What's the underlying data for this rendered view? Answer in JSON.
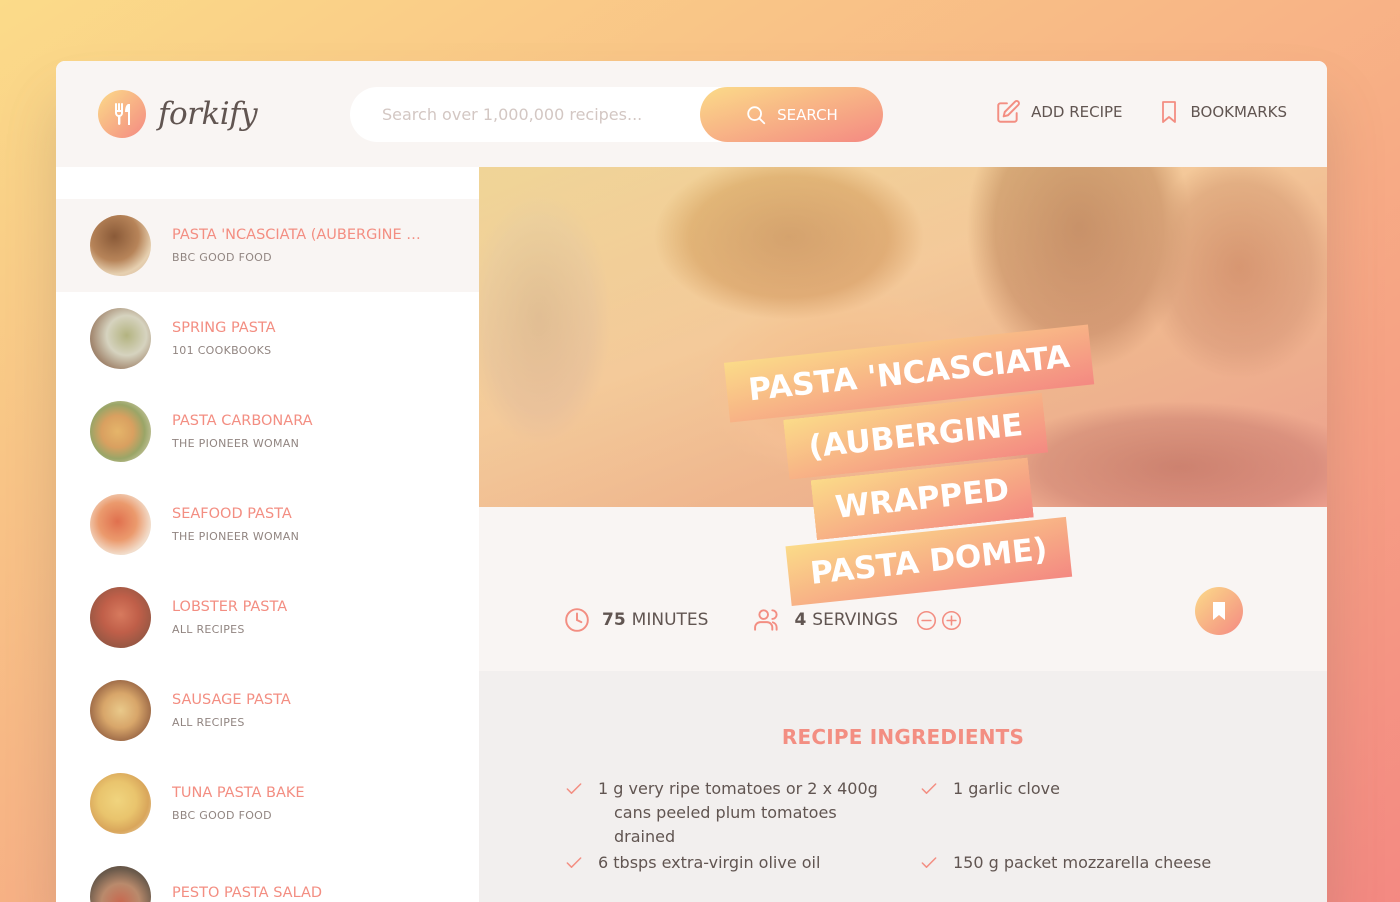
{
  "header": {
    "logo_text": "forkify",
    "search_placeholder": "Search over 1,000,000 recipes...",
    "search_label": "SEARCH",
    "add_recipe_label": "ADD RECIPE",
    "bookmarks_label": "BOOKMARKS"
  },
  "results": [
    {
      "title": "PASTA 'NCASCIATA (AUBERGINE WRAPPED PASTA DOME)",
      "publisher": "BBC GOOD FOOD",
      "active": true
    },
    {
      "title": "SPRING PASTA",
      "publisher": "101 COOKBOOKS"
    },
    {
      "title": "PASTA CARBONARA",
      "publisher": "THE PIONEER WOMAN"
    },
    {
      "title": "SEAFOOD PASTA",
      "publisher": "THE PIONEER WOMAN"
    },
    {
      "title": "LOBSTER PASTA",
      "publisher": "ALL RECIPES"
    },
    {
      "title": "SAUSAGE PASTA",
      "publisher": "ALL RECIPES"
    },
    {
      "title": "TUNA PASTA BAKE",
      "publisher": "BBC GOOD FOOD"
    },
    {
      "title": "PESTO PASTA SALAD",
      "publisher": ""
    }
  ],
  "recipe": {
    "title_lines": [
      "PASTA 'NCASCIATA",
      "(AUBERGINE WRAPPED",
      "PASTA DOME)"
    ],
    "minutes": "75",
    "minutes_label": "MINUTES",
    "servings": "4",
    "servings_label": "SERVINGS",
    "ingredients_heading": "RECIPE INGREDIENTS",
    "ingredients": [
      {
        "line1": "1 g very ripe tomatoes or 2 x 400g",
        "line2": "cans peeled plum tomatoes drained"
      },
      {
        "line1": "1 garlic clove",
        "line2": ""
      },
      {
        "line1": "6 tbsps extra-virgin olive oil",
        "line2": ""
      },
      {
        "line1": "150 g packet mozzarella cheese",
        "line2": ""
      }
    ]
  },
  "colors": {
    "accent": "#f38e82",
    "gradient_start": "#fbdb89",
    "gradient_end": "#f48982",
    "text": "#615551",
    "panel_bg": "#f9f5f3"
  }
}
